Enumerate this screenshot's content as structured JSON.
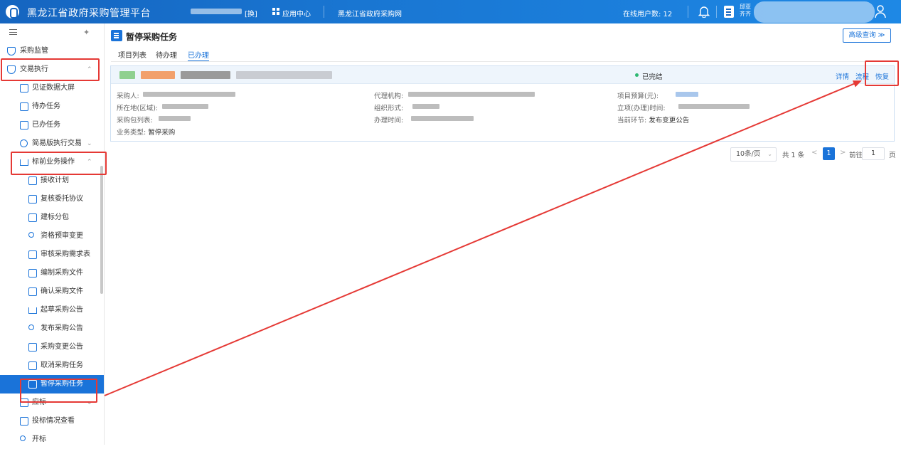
{
  "topbar": {
    "title": "黑龙江省政府采购管理平台",
    "mid_link_suffix": "[换]",
    "app_center": "应用中心",
    "portal_link": "黑龙江省政府采购网",
    "online_users": "在线用户数: 12",
    "user_line1": "邱亚",
    "user_line2": "齐齐"
  },
  "sidebar": {
    "items": [
      {
        "label": "采购监管",
        "icon": "shield-icon"
      },
      {
        "label": "交易执行",
        "icon": "shield-icon",
        "chevron": "⌃"
      },
      {
        "label": "见证数据大屏",
        "icon": "monitor-icon"
      },
      {
        "label": "待办任务",
        "icon": "task-icon"
      },
      {
        "label": "已办任务",
        "icon": "task-done-icon"
      },
      {
        "label": "简易版执行交易",
        "icon": "transaction-icon",
        "chevron": "⌄"
      },
      {
        "label": "标前业务操作",
        "icon": "cart-icon",
        "chevron": "⌃"
      },
      {
        "label": "接收计划",
        "icon": "receive-icon"
      },
      {
        "label": "复核委托协议",
        "icon": "document-icon"
      },
      {
        "label": "建标分包",
        "icon": "package-icon"
      },
      {
        "label": "资格预审变更",
        "icon": "people-icon"
      },
      {
        "label": "审核采购需求表",
        "icon": "clipboard-icon"
      },
      {
        "label": "编制采购文件",
        "icon": "document-icon"
      },
      {
        "label": "确认采购文件",
        "icon": "confirm-icon"
      },
      {
        "label": "起草采购公告",
        "icon": "cart-icon"
      },
      {
        "label": "发布采购公告",
        "icon": "people-icon"
      },
      {
        "label": "采购变更公告",
        "icon": "list-icon"
      },
      {
        "label": "取消采购任务",
        "icon": "task-icon"
      },
      {
        "label": "暂停采购任务",
        "icon": "task-icon"
      },
      {
        "label": "应标",
        "icon": "bid-icon",
        "chevron": "⌄"
      },
      {
        "label": "投标情况查看",
        "icon": "view-icon"
      },
      {
        "label": "开标",
        "icon": "open-icon"
      }
    ]
  },
  "main": {
    "title": "暂停采购任务",
    "advanced_search": "高级查询 ≫",
    "tabs": [
      "项目列表",
      "待办理",
      "已办理"
    ],
    "record": {
      "status": "已完结",
      "actions": [
        "详情",
        "流程",
        "恢复"
      ],
      "fields": {
        "purchaser": "采购人:",
        "region": "所在地(区域):",
        "package_list": "采购包列表:",
        "business_type_label": "业务类型:",
        "business_type_value": "暂停采购",
        "agency": "代理机构:",
        "org_form": "组织形式:",
        "handle_time": "办理时间:",
        "budget": "项目预算(元):",
        "setup_time": "立项(办理)时间:",
        "current_stage_label": "当前环节:",
        "current_stage_value": "发布变更公告"
      }
    },
    "pagination": {
      "page_size": "10条/页",
      "total": "共 1 条",
      "prev": "<",
      "current": "1",
      "next": ">",
      "goto_label": "前往",
      "goto_value": "1",
      "page_unit": "页"
    }
  },
  "colors": {
    "topbar": "#1976d2",
    "accent": "#1a73d9",
    "highlight": "#e53935",
    "status_ok": "#2eb872"
  }
}
